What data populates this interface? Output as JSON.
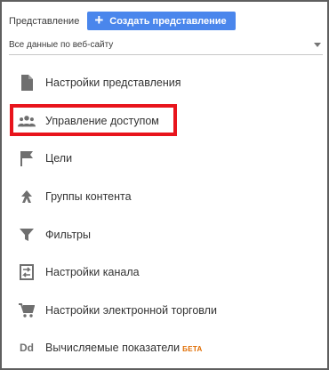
{
  "header": {
    "label": "Представление",
    "create_button": {
      "plus": "+",
      "label": "Создать представление"
    }
  },
  "view_select": {
    "value": "Все данные по веб-сайту"
  },
  "menu": {
    "items": [
      {
        "icon": "document-icon",
        "label": "Настройки представления"
      },
      {
        "icon": "people-icon",
        "label": "Управление доступом"
      },
      {
        "icon": "flag-icon",
        "label": "Цели"
      },
      {
        "icon": "content-grouping-icon",
        "label": "Группы контента"
      },
      {
        "icon": "filter-icon",
        "label": "Фильтры"
      },
      {
        "icon": "channel-settings-icon",
        "label": "Настройки канала"
      },
      {
        "icon": "shopping-cart-icon",
        "label": "Настройки электронной торговли"
      },
      {
        "icon": "calculated-metrics-icon",
        "icon_text": "Dd",
        "label": "Вычисляемые показатели",
        "badge": "БЕТА"
      }
    ]
  },
  "colors": {
    "accent_button": "#4a86ec",
    "highlight_border": "#e8141c",
    "badge": "#e06c00",
    "icon": "#6f6f6f"
  }
}
